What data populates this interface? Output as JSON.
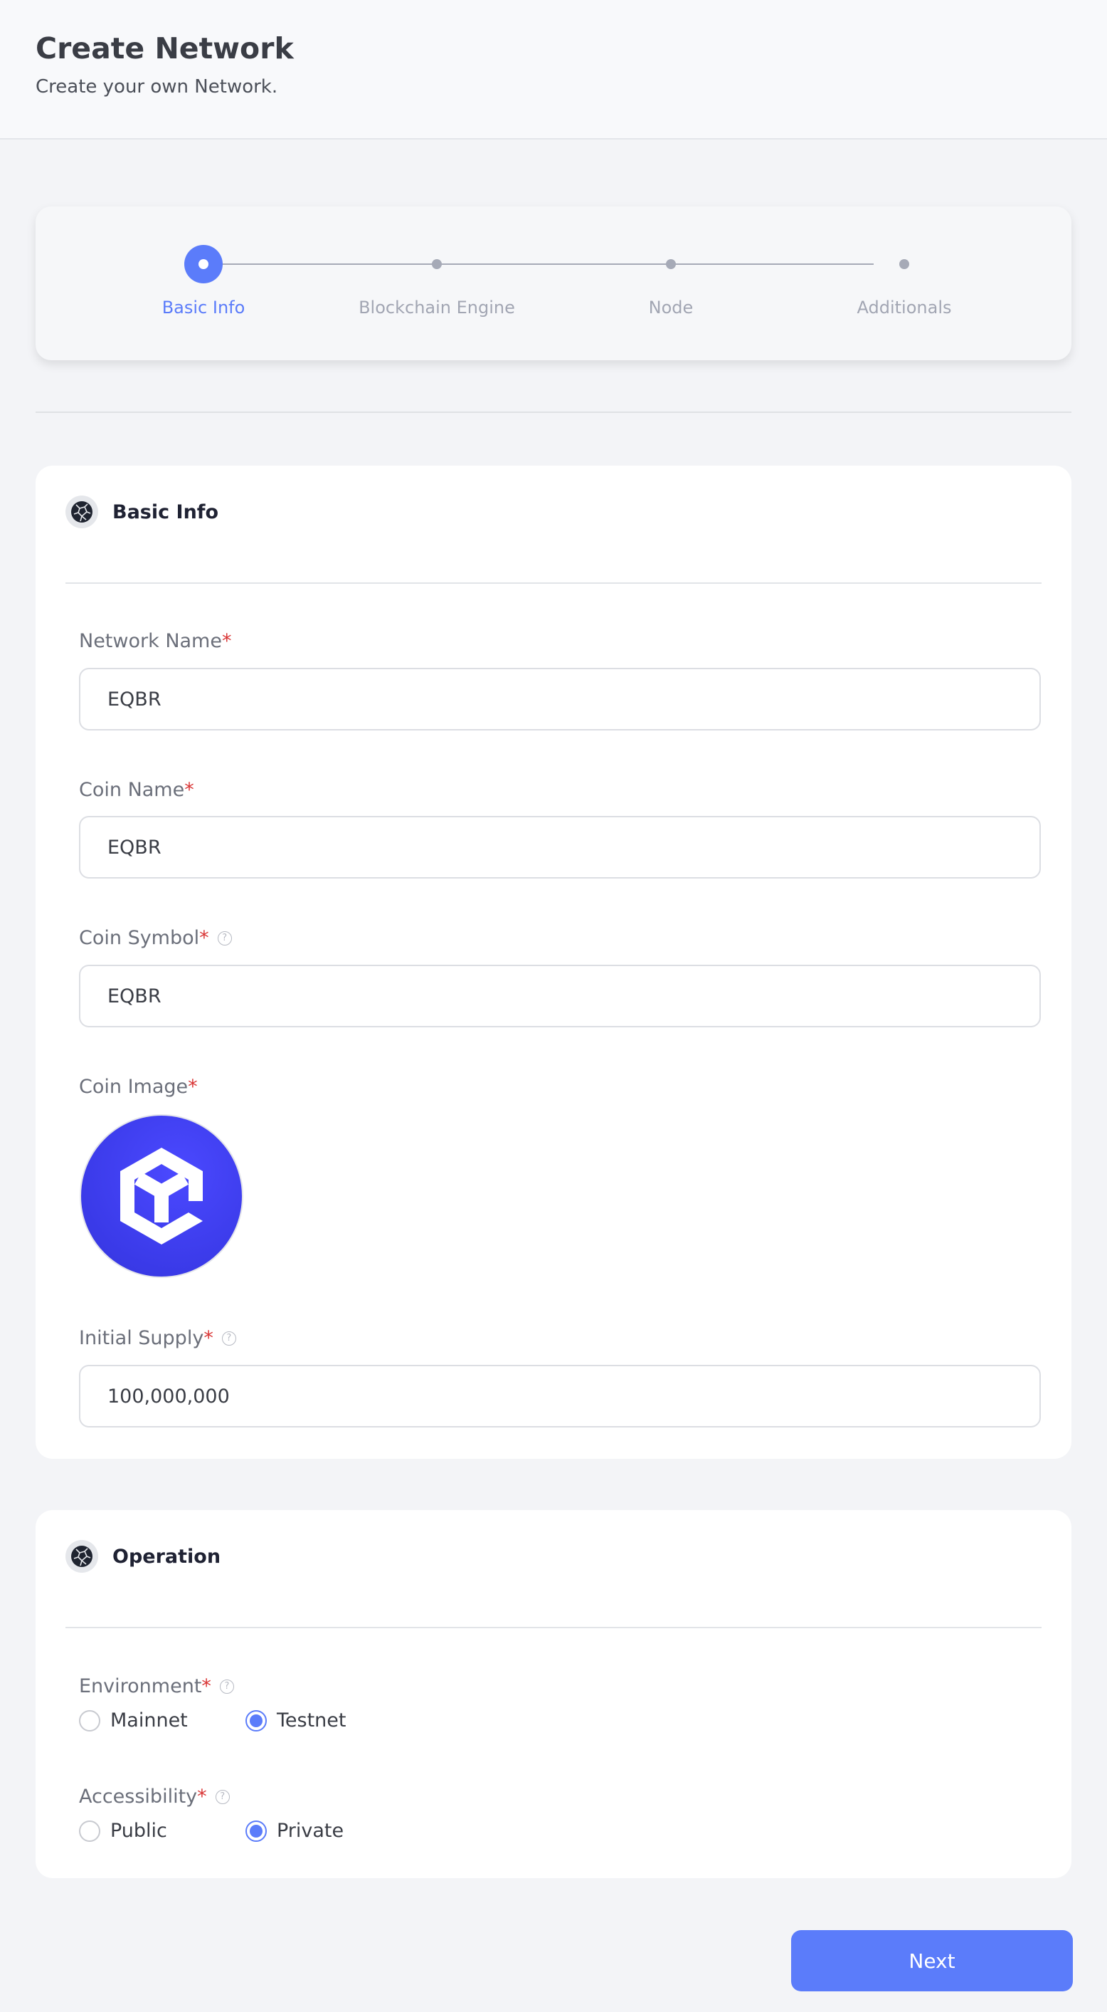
{
  "header": {
    "title": "Create Network",
    "subtitle": "Create your own Network."
  },
  "stepper": {
    "steps": [
      {
        "label": "Basic Info",
        "state": "active"
      },
      {
        "label": "Blockchain Engine",
        "state": "pending"
      },
      {
        "label": "Node",
        "state": "pending"
      },
      {
        "label": "Additionals",
        "state": "pending"
      }
    ]
  },
  "basic_info": {
    "title": "Basic Info",
    "icon": "globe-icon",
    "network_name": {
      "label": "Network Name",
      "required": "*",
      "value": "EQBR"
    },
    "coin_name": {
      "label": "Coin Name",
      "required": "*",
      "value": "EQBR"
    },
    "coin_symbol": {
      "label": "Coin Symbol",
      "required": "*",
      "help": "?",
      "value": "EQBR"
    },
    "coin_image": {
      "label": "Coin Image",
      "required": "*",
      "icon": "cube-logo-icon"
    },
    "initial_supply": {
      "label": "Initial Supply",
      "required": "*",
      "help": "?",
      "value": "100,000,000"
    }
  },
  "operation": {
    "title": "Operation",
    "icon": "globe-icon",
    "environment": {
      "label": "Environment",
      "required": "*",
      "help": "?",
      "options": [
        "Mainnet",
        "Testnet"
      ],
      "selected": "Testnet"
    },
    "accessibility": {
      "label": "Accessibility",
      "required": "*",
      "help": "?",
      "options": [
        "Public",
        "Private"
      ],
      "selected": "Private"
    }
  },
  "footer": {
    "next_label": "Next"
  },
  "colors": {
    "accent": "#5b7cfa",
    "required": "#d93636",
    "background": "#f3f4f7",
    "card": "#ffffff"
  }
}
